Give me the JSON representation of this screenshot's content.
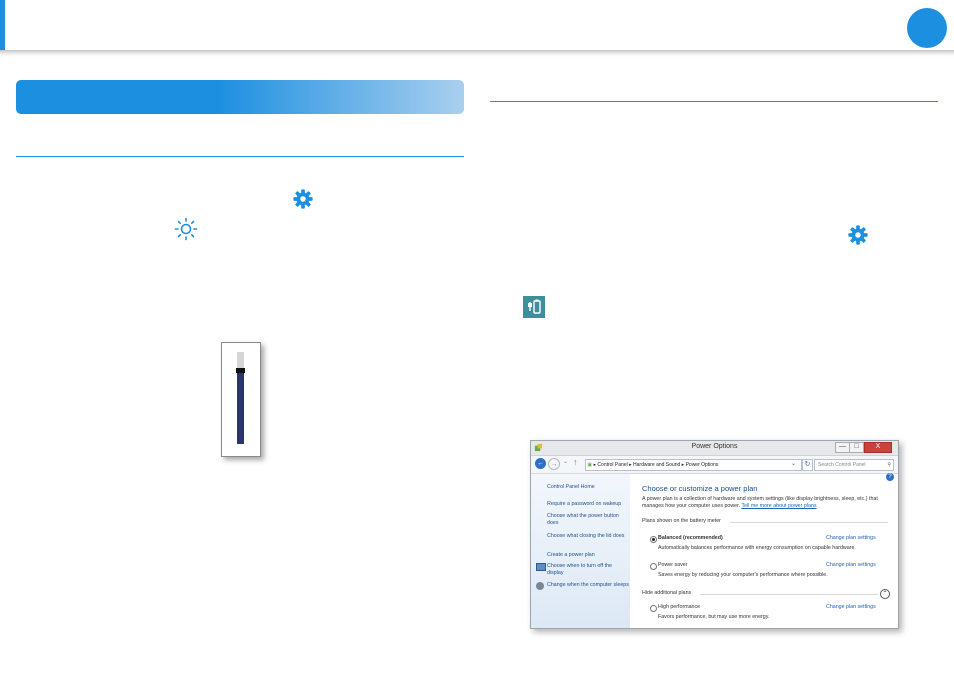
{
  "colors": {
    "accent": "#1d8fe0",
    "slider_fill": "#2b3472",
    "power_tile": "#3d8f9b"
  },
  "icons": [
    "gear-icon",
    "brightness-icon",
    "battery-plug-icon"
  ],
  "brightness_level": 0.8,
  "window": {
    "title": "Power Options",
    "controls": {
      "minimize": "—",
      "maximize": "□",
      "close": "X"
    },
    "address": {
      "path": [
        "Control Panel",
        "Hardware and Sound",
        "Power Options"
      ]
    },
    "search_placeholder": "Search Control Panel",
    "sidebar": {
      "home": "Control Panel Home",
      "links": [
        "Require a password on wakeup",
        "Choose what the power button does",
        "Choose what closing the lid does",
        "Create a power plan",
        "Choose when to turn off the display",
        "Change when the computer sleeps"
      ]
    },
    "main": {
      "heading": "Choose or customize a power plan",
      "intro": "A power plan is a collection of hardware and system settings (like display brightness, sleep, etc.) that manages how your computer uses power.",
      "intro_link": "Tell me more about power plans",
      "section_battery": "Plans shown on the battery meter",
      "section_hidden": "Hide additional plans",
      "change_label": "Change plan settings",
      "plans": [
        {
          "name": "Balanced (recommended)",
          "desc": "Automatically balances performance with energy consumption on capable hardware.",
          "selected": true
        },
        {
          "name": "Power saver",
          "desc": "Saves energy by reducing your computer's performance where possible.",
          "selected": false
        },
        {
          "name": "High performance",
          "desc": "Favors performance, but may use more energy.",
          "selected": false
        }
      ],
      "help": "?"
    }
  }
}
